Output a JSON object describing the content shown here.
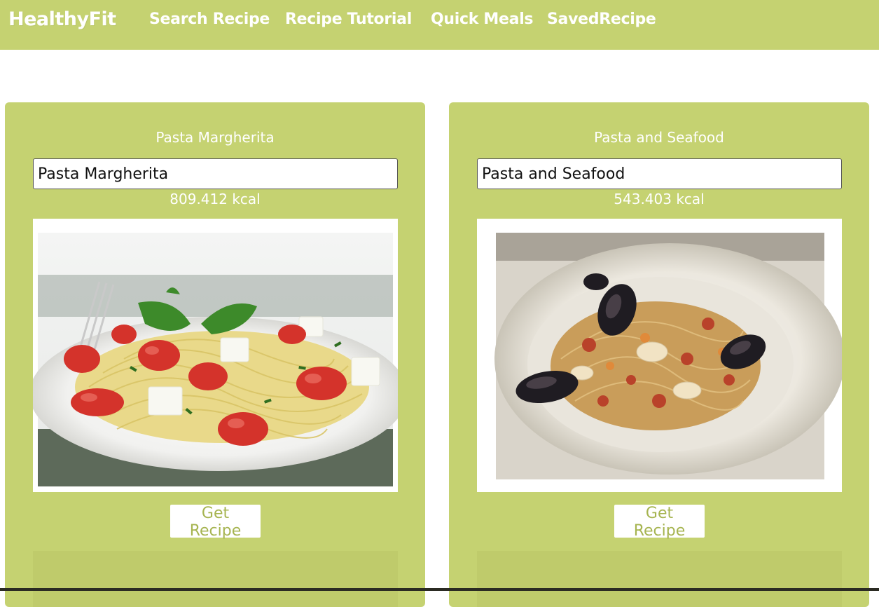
{
  "nav": {
    "brand": "HealthyFit",
    "links": [
      "Search Recipe",
      "Recipe Tutorial",
      "Quick Meals",
      "SavedRecipe"
    ]
  },
  "colors": {
    "navbar": "#c5d271",
    "card": "#c5d271",
    "button_text": "#a6b450",
    "detail_box": "#bfcb6b"
  },
  "recipes": [
    {
      "title": "Pasta Margherita",
      "input_value": "Pasta Margherita",
      "kcal": "809.412 kcal",
      "image": "pasta-margherita-photo",
      "button_label": "Get Recipe"
    },
    {
      "title": "Pasta and Seafood",
      "input_value": "Pasta and Seafood",
      "kcal": "543.403 kcal",
      "image": "pasta-seafood-photo",
      "button_label": "Get Recipe"
    }
  ]
}
